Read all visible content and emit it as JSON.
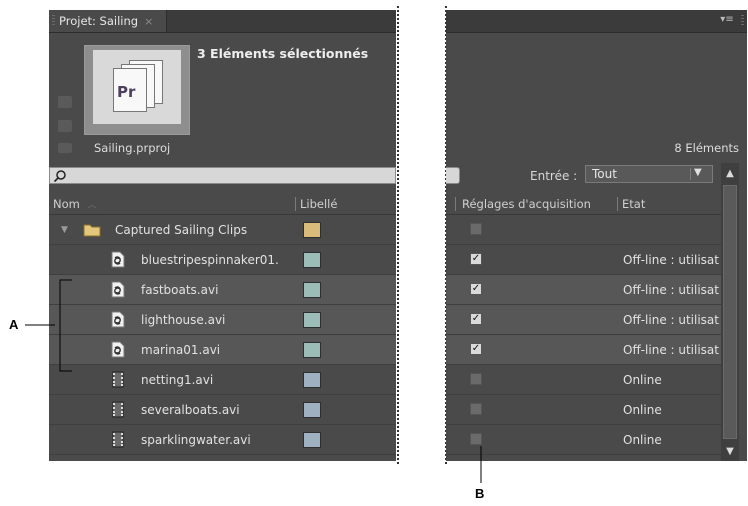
{
  "left_panel": {
    "tab_label": "Projet: Sailing",
    "tab_close": "×",
    "selection_count": "3 Eléments sélectionnés",
    "thumbnail_text": "Pr",
    "project_file": "Sailing.prproj",
    "search_placeholder": "",
    "columns": {
      "name": "Nom",
      "label": "Libellé"
    },
    "folder": {
      "name": "Captured Sailing Clips",
      "expanded": true,
      "label_color": "#d9bb7a"
    },
    "items": [
      {
        "name": "bluestripespinnaker01.",
        "type": "offline-clip",
        "label_color": "#9bbcb7",
        "selected": false
      },
      {
        "name": "fastboats.avi",
        "type": "offline-clip",
        "label_color": "#9bbcb7",
        "selected": true
      },
      {
        "name": "lighthouse.avi",
        "type": "offline-clip",
        "label_color": "#9bbcb7",
        "selected": true
      },
      {
        "name": "marina01.avi",
        "type": "offline-clip",
        "label_color": "#9bbcb7",
        "selected": true
      },
      {
        "name": "netting1.avi",
        "type": "video-clip",
        "label_color": "#9fb0c0",
        "selected": false
      },
      {
        "name": "severalboats.avi",
        "type": "video-clip",
        "label_color": "#9fb0c0",
        "selected": false
      },
      {
        "name": "sparklingwater.avi",
        "type": "video-clip",
        "label_color": "#9fb0c0",
        "selected": false
      }
    ]
  },
  "right_panel": {
    "menu_icon": "panel-menu-icon",
    "item_count": "8 Eléments",
    "entree_label": "Entrée :",
    "entree_value": "Tout",
    "columns": {
      "acquisition": "Réglages d'acquisition",
      "state": "Etat"
    },
    "rows": [
      {
        "checked": false,
        "state": "",
        "selected": false
      },
      {
        "checked": true,
        "state": "Off-line : utilisat",
        "selected": false
      },
      {
        "checked": true,
        "state": "Off-line : utilisat",
        "selected": true
      },
      {
        "checked": true,
        "state": "Off-line : utilisat",
        "selected": true
      },
      {
        "checked": true,
        "state": "Off-line : utilisat",
        "selected": true
      },
      {
        "checked": false,
        "state": "Online",
        "selected": false
      },
      {
        "checked": false,
        "state": "Online",
        "selected": false
      },
      {
        "checked": false,
        "state": "Online",
        "selected": false
      }
    ]
  },
  "callouts": {
    "a": "A",
    "b": "B"
  },
  "colors": {
    "panel_bg": "#4a4a4a",
    "selected_row": "#575757",
    "text": "#e2e2e2"
  }
}
